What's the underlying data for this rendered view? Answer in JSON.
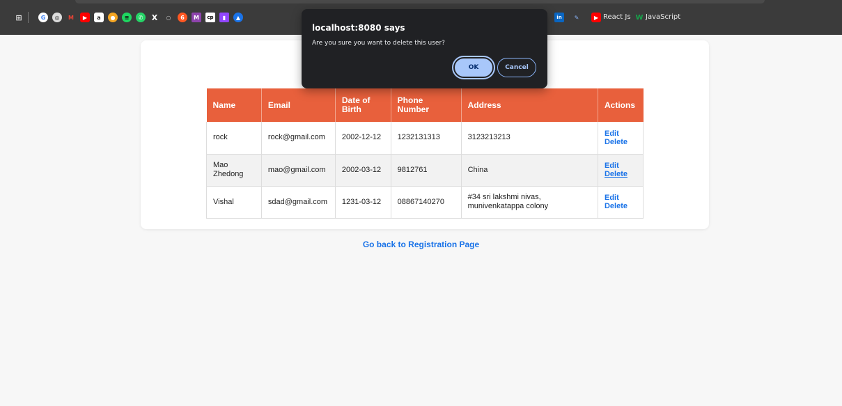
{
  "bookmarks": {
    "labels": [
      "React Js",
      "JavaScript"
    ]
  },
  "dialog": {
    "title": "localhost:8080 says",
    "message": "Are you sure you want to delete this user?",
    "ok_label": "OK",
    "cancel_label": "Cancel"
  },
  "table": {
    "headers": [
      "Name",
      "Email",
      "Date of Birth",
      "Phone Number",
      "Address",
      "Actions"
    ],
    "rows": [
      {
        "name": "rock",
        "email": "rock@gmail.com",
        "dob": "2002-12-12",
        "phone": "1232131313",
        "address": "3123213213",
        "edit": "Edit",
        "delete": "Delete"
      },
      {
        "name": "Mao Zhedong",
        "email": "mao@gmail.com",
        "dob": "2002-03-12",
        "phone": "9812761",
        "address": "China",
        "edit": "Edit",
        "delete": "Delete"
      },
      {
        "name": "Vishal",
        "email": "sdad@gmail.com",
        "dob": "1231-03-12",
        "phone": "08867140270",
        "address": "#34 sri lakshmi nivas, munivenkatappa colony",
        "edit": "Edit",
        "delete": "Delete"
      }
    ]
  },
  "back_link": "Go back to Registration Page",
  "colors": {
    "header_bg": "#e8603c",
    "link": "#1a73e8",
    "dialog_bg": "#202124",
    "ok_bg": "#a8c7fa"
  }
}
